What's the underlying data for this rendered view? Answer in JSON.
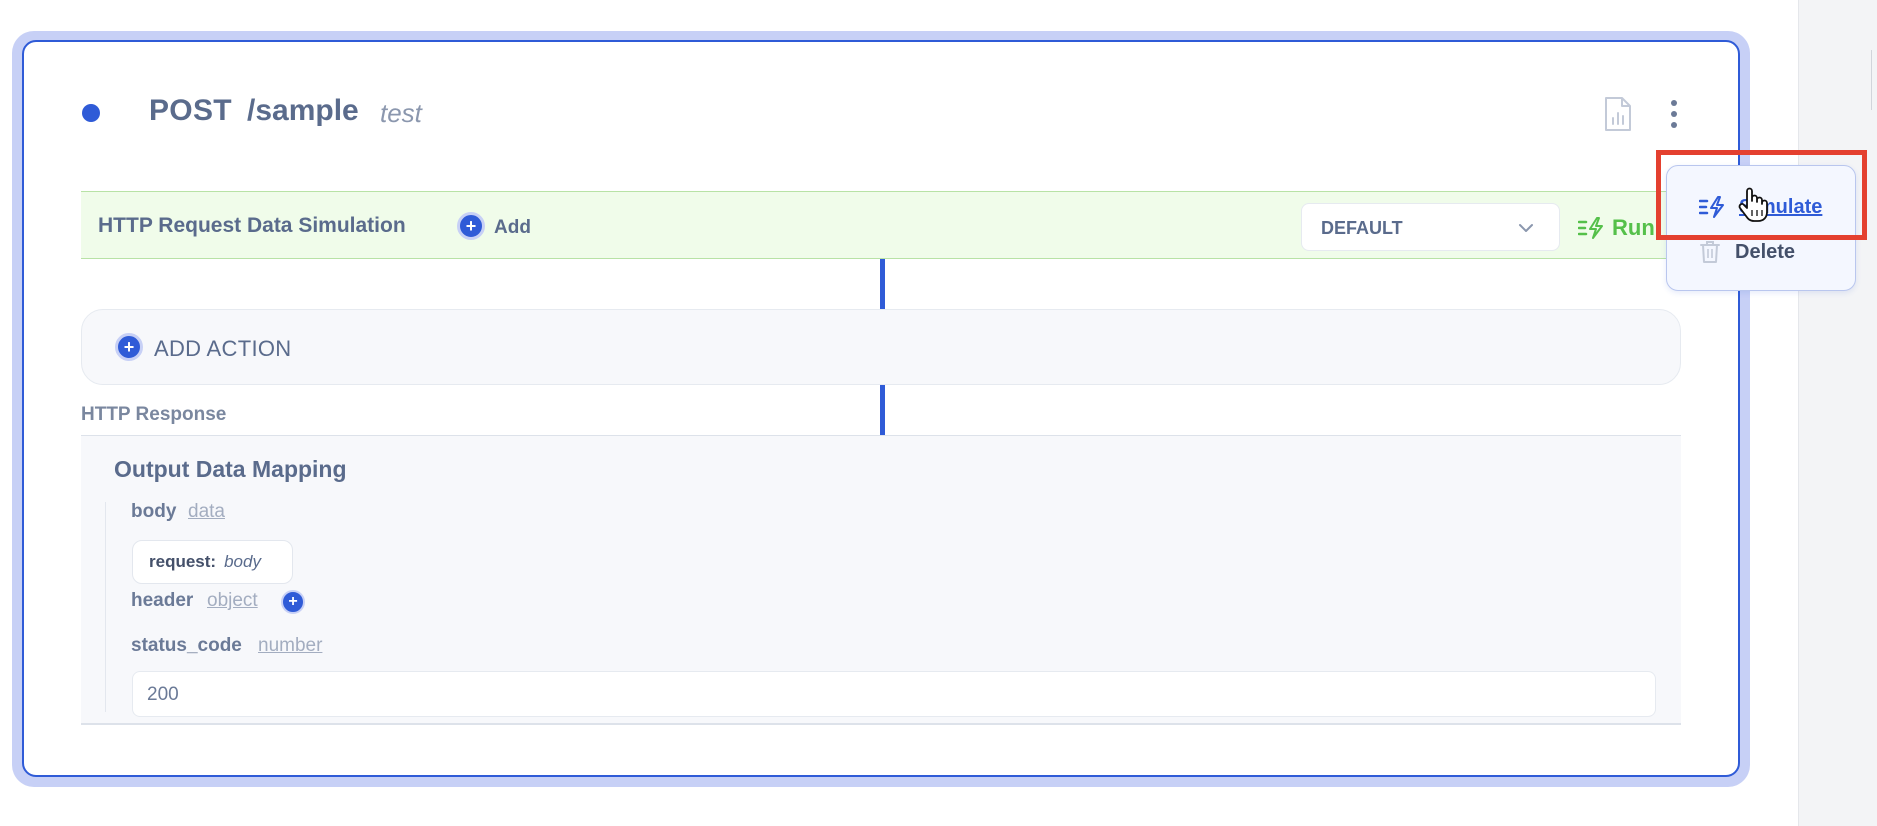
{
  "route": {
    "method": "POST",
    "path": "/sample",
    "name": "test"
  },
  "simulation": {
    "title": "HTTP Request Data Simulation",
    "add_label": "Add",
    "select_value": "DEFAULT",
    "run_label": "Run"
  },
  "add_action": {
    "label": "ADD ACTION"
  },
  "response": {
    "section_label": "HTTP Response",
    "mapping_title": "Output Data Mapping",
    "fields": {
      "body": {
        "key": "body",
        "type": "data"
      },
      "body_chip": {
        "key": "request:",
        "value": "body"
      },
      "header": {
        "key": "header",
        "type": "object"
      },
      "status_code": {
        "key": "status_code",
        "type": "number",
        "value": "200"
      }
    }
  },
  "menu": {
    "simulate_label": "Simulate",
    "delete_label": "Delete"
  },
  "colors": {
    "accent": "#2f5bd7",
    "run_green": "#55c04a",
    "highlight_red": "#e4402f",
    "sim_bar_bg": "#f0fcea"
  },
  "icons": {
    "status": "status-dot",
    "report": "file-chart-icon",
    "more": "kebab-menu-icon",
    "run": "lightning-list-icon",
    "delete": "trash-icon"
  }
}
